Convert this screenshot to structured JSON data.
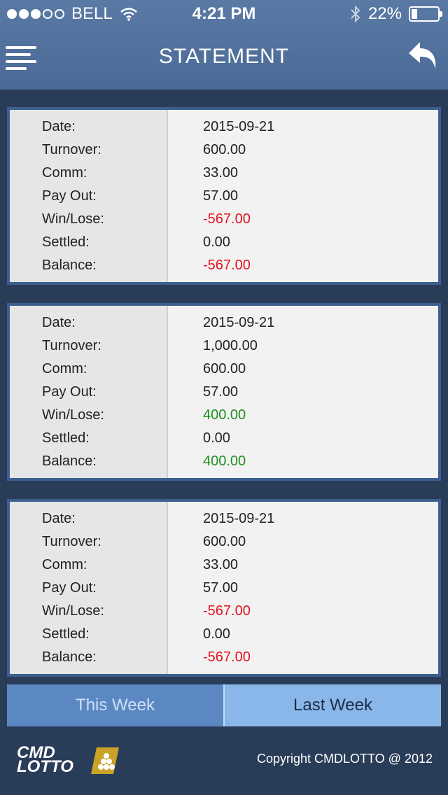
{
  "status": {
    "carrier": "BELL",
    "time": "4:21 PM",
    "battery": "22%",
    "signal_strength": 3,
    "signal_total": 5,
    "battery_level": 0.22
  },
  "nav": {
    "title": "STATEMENT",
    "menu_icon": "hamburger-icon",
    "back_icon": "reply-arrow-icon"
  },
  "labels": {
    "date": "Date:",
    "turnover": "Turnover:",
    "comm": "Comm:",
    "payout": "Pay Out:",
    "winlose": "Win/Lose:",
    "settled": "Settled:",
    "balance": "Balance:"
  },
  "statements": [
    {
      "date": "2015-09-21",
      "turnover": "600.00",
      "comm": "33.00",
      "payout": "57.00",
      "winlose": "-567.00",
      "settled": "0.00",
      "balance": "-567.00"
    },
    {
      "date": "2015-09-21",
      "turnover": "1,000.00",
      "comm": "600.00",
      "payout": "57.00",
      "winlose": "400.00",
      "settled": "0.00",
      "balance": "400.00"
    },
    {
      "date": "2015-09-21",
      "turnover": "600.00",
      "comm": "33.00",
      "payout": "57.00",
      "winlose": "-567.00",
      "settled": "0.00",
      "balance": "-567.00"
    }
  ],
  "tabs": {
    "this_week": "This Week",
    "last_week": "Last Week"
  },
  "footer": {
    "logo_line1": "CMD",
    "logo_line2": "LOTTO",
    "copyright": "Copyright CMDLOTTO @ 2012"
  },
  "colors": {
    "negative": "#e0141e",
    "positive": "#1e8f1e",
    "accent": "#4b6a96"
  }
}
